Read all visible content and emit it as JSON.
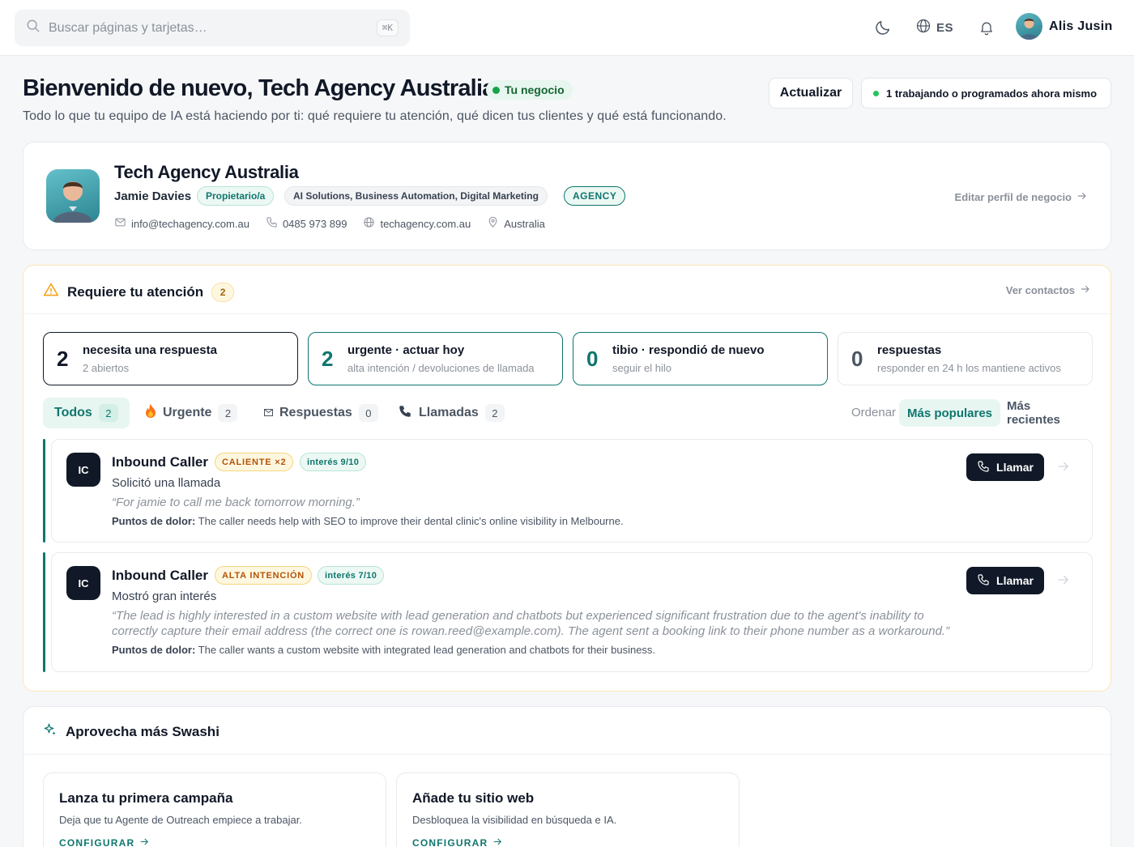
{
  "topbar": {
    "search_placeholder": "Buscar páginas y tarjetas…",
    "search_shortcut": "⌘K",
    "language": "ES",
    "user_name": "Alis Jusin"
  },
  "header": {
    "title": "Bienvenido de nuevo, Tech Agency Australia",
    "business_pill": "Tu negocio",
    "subtitle": "Todo lo que tu equipo de IA está haciendo por ti: qué requiere tu atención, qué dicen tus clientes y qué está funcionando.",
    "refresh_label": "Actualizar",
    "status_text": "1 trabajando o programados ahora mismo"
  },
  "profile": {
    "business_name": "Tech Agency Australia",
    "owner_name": "Jamie Davies",
    "owner_role": "Propietario/a",
    "categories": "AI Solutions, Business Automation, Digital Marketing",
    "type_tag": "AGENCY",
    "email": "info@techagency.com.au",
    "phone": "0485 973 899",
    "website": "techagency.com.au",
    "location": "Australia",
    "edit_link": "Editar perfil de negocio"
  },
  "attention": {
    "title": "Requiere tu atención",
    "count": "2",
    "view_contacts": "Ver contactos",
    "stats": [
      {
        "value": "2",
        "title": "necesita una respuesta",
        "sub": "2 abiertos"
      },
      {
        "value": "2",
        "title": "urgente · actuar hoy",
        "sub": "alta intención / devoluciones de llamada"
      },
      {
        "value": "0",
        "title": "tibio · respondió de nuevo",
        "sub": "seguir el hilo"
      },
      {
        "value": "0",
        "title": "respuestas",
        "sub": "responder en 24 h los mantiene activos"
      }
    ],
    "filters": [
      {
        "label": "Todos",
        "count": "2"
      },
      {
        "label": "Urgente",
        "count": "2"
      },
      {
        "label": "Respuestas",
        "count": "0"
      },
      {
        "label": "Llamadas",
        "count": "2"
      }
    ],
    "sort_label": "Ordenar",
    "sort_options": [
      "Más populares",
      "Más recientes"
    ],
    "pain_label": "Puntos de dolor:",
    "call_label": "Llamar",
    "leads": [
      {
        "initials": "IC",
        "name": "Inbound Caller",
        "badge": "CALIENTE ×2",
        "interest": "interés 9/10",
        "action": "Solicitó una llamada",
        "quote": "“For jamie to call me back tomorrow morning.”",
        "pain": "The caller needs help with SEO to improve their dental clinic's online visibility in Melbourne."
      },
      {
        "initials": "IC",
        "name": "Inbound Caller",
        "badge": "ALTA INTENCIÓN",
        "interest": "interés 7/10",
        "action": "Mostró gran interés",
        "quote": "“The lead is highly interested in a custom website with lead generation and chatbots but experienced significant frustration due to the agent's inability to correctly capture their email address (the correct one is rowan.reed@example.com). The agent sent a booking link to their phone number as a workaround.”",
        "pain": "The caller wants a custom website with integrated lead generation and chatbots for their business."
      }
    ]
  },
  "swashi": {
    "title": "Aprovecha más Swashi",
    "cards": [
      {
        "title": "Lanza tu primera campaña",
        "desc": "Deja que tu Agente de Outreach empiece a trabajar.",
        "link": "CONFIGURAR"
      },
      {
        "title": "Añade tu sitio web",
        "desc": "Desbloquea la visibilidad en búsqueda e IA.",
        "link": "CONFIGURAR"
      }
    ]
  },
  "colors": {
    "accent": "#0f766e",
    "warning": "#f59e0b",
    "dark": "#111827"
  }
}
